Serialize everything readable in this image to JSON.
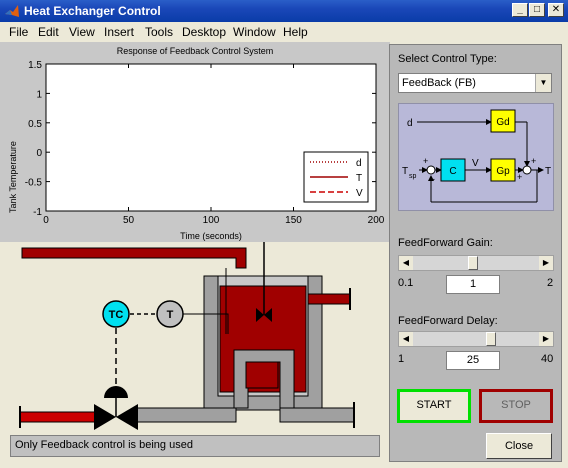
{
  "window": {
    "title": "Heat Exchanger Control",
    "minimize": "_",
    "maximize": "□",
    "close": "✕"
  },
  "menu": {
    "items": [
      "File",
      "Edit",
      "View",
      "Insert",
      "Tools",
      "Desktop",
      "Window",
      "Help"
    ]
  },
  "chart_data": {
    "type": "line",
    "title": "Response of Feedback Control System",
    "xlabel": "Time (seconds)",
    "ylabel": "Tank Temperature",
    "xlim": [
      0,
      200
    ],
    "ylim": [
      -1,
      1.5
    ],
    "xticks": [
      "0",
      "50",
      "100",
      "150",
      "200"
    ],
    "yticks": [
      "1.5",
      "1",
      "0.5",
      "0",
      "-0.5",
      "-1"
    ],
    "series": [
      {
        "name": "d",
        "values": [],
        "color": "#a00000",
        "style": "dotted"
      },
      {
        "name": "T",
        "values": [],
        "color": "#a00000",
        "style": "solid"
      },
      {
        "name": "V",
        "values": [],
        "color": "#cc0000",
        "style": "dashed"
      }
    ],
    "legend": "right",
    "grid": false
  },
  "process": {
    "controller_label": "TC",
    "sensor_label": "T"
  },
  "panel": {
    "control_type_label": "Select Control Type:",
    "control_type_value": "FeedBack (FB)",
    "diagram": {
      "d": "d",
      "gd": "Gd",
      "c": "C",
      "gp": "Gp",
      "v": "V",
      "t": "T",
      "tsp": "T",
      "tsp_sub": "sp",
      "plus": "+",
      "minus": "-"
    },
    "ff_gain_label": "FeedForward Gain:",
    "ff_gain_min": "0.1",
    "ff_gain_max": "2",
    "ff_gain_value": "1",
    "ff_gain_level": 0.47,
    "ff_delay_label": "FeedForward Delay:",
    "ff_delay_min": "1",
    "ff_delay_max": "40",
    "ff_delay_value": "25",
    "ff_delay_level": 0.62,
    "start": "START",
    "stop": "STOP"
  },
  "status_text": "Only Feedback control is being used",
  "close_label": "Close",
  "colors": {
    "accent_red": "#a00000",
    "pipe_red": "#cc0000",
    "controller_cyan": "#00e0f0",
    "start_green": "#00e000"
  }
}
